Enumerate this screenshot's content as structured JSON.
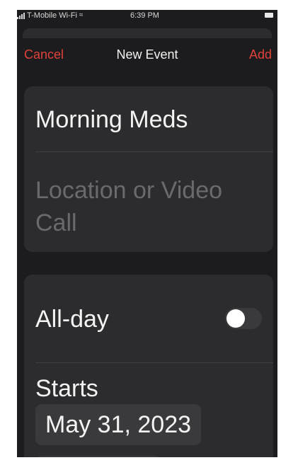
{
  "status_bar": {
    "carrier": "T-Mobile Wi-Fi",
    "time": "6:39 PM",
    "icons": [
      "signal-icon",
      "wifi-icon",
      "battery-icon"
    ]
  },
  "nav": {
    "cancel_label": "Cancel",
    "title": "New Event",
    "add_label": "Add"
  },
  "event": {
    "title_value": "Morning Meds",
    "location_placeholder": "Location or Video Call"
  },
  "all_day": {
    "label": "All-day",
    "enabled": false
  },
  "starts": {
    "label": "Starts",
    "date": "May 31, 2023"
  },
  "colors": {
    "accent": "#e0413a",
    "background": "#1c1c1e",
    "card": "#2c2c2e",
    "pill": "#3a3a3c"
  }
}
